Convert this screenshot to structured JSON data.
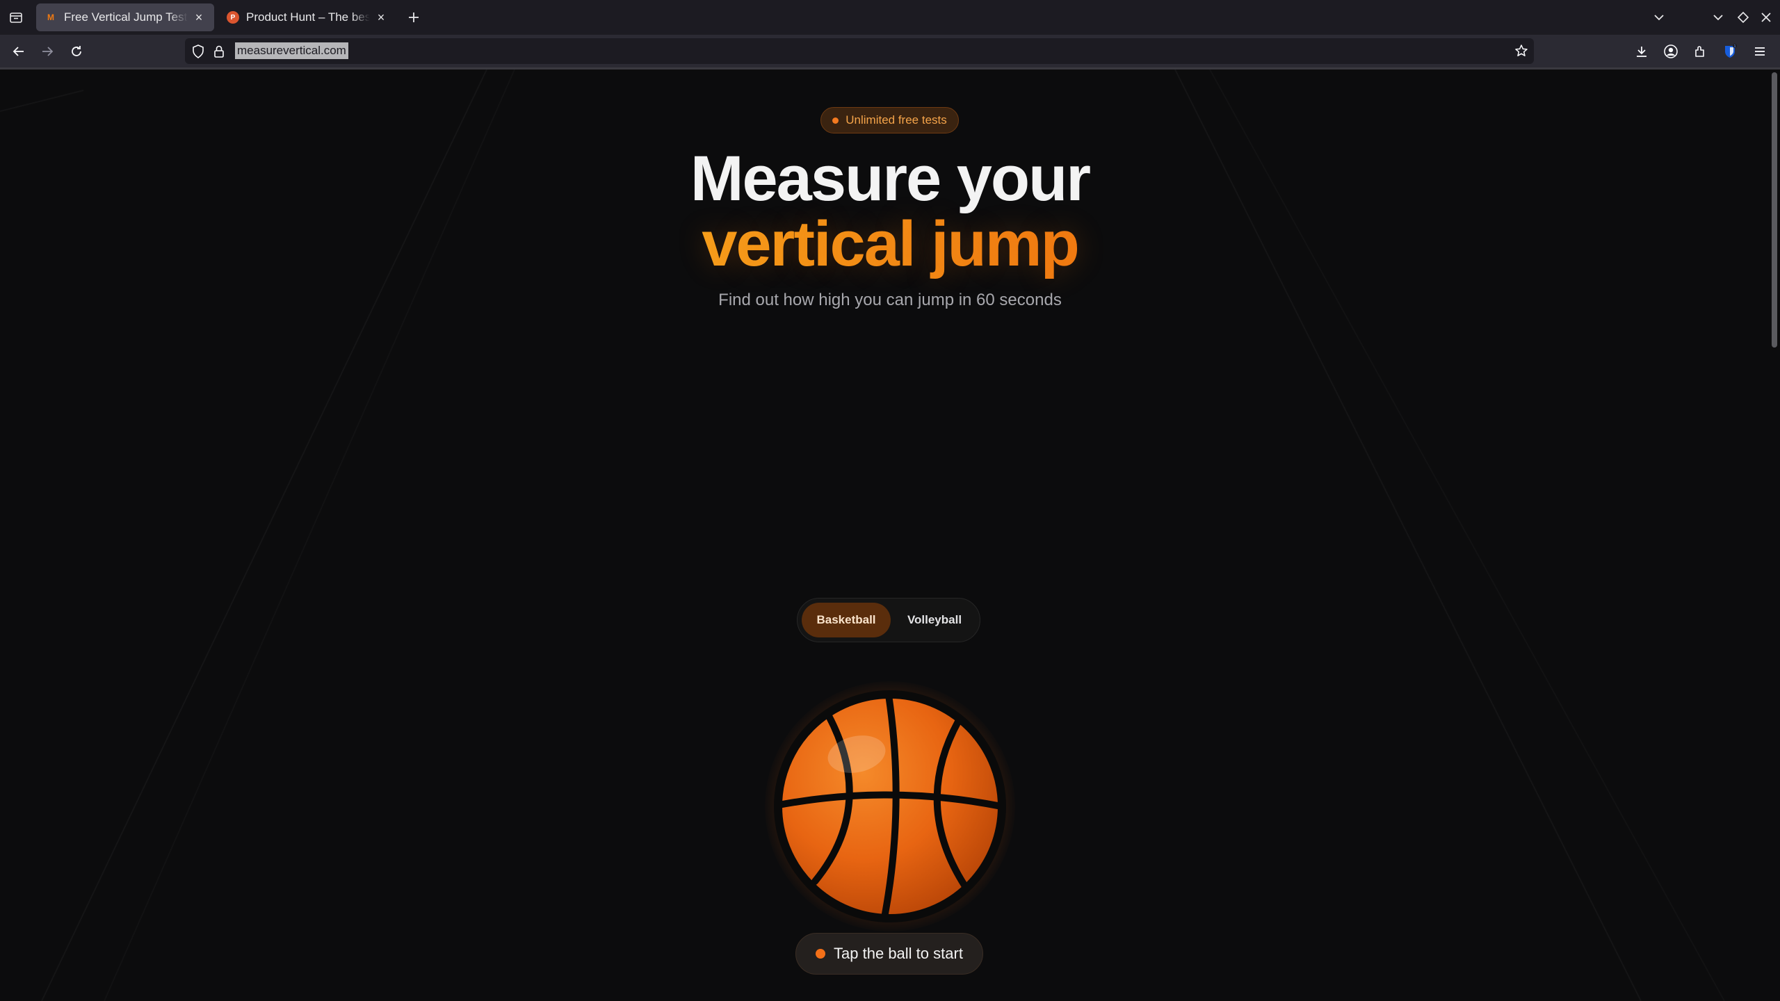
{
  "browser": {
    "tabs": [
      {
        "title": "Free Vertical Jump Test | M",
        "favicon": "measurevertical-favicon",
        "active": true
      },
      {
        "title": "Product Hunt – The best ne",
        "favicon": "producthunt-favicon",
        "active": false
      }
    ],
    "url": "measurevertical.com",
    "favicon_letters": {
      "m": "M",
      "p": "P"
    }
  },
  "page": {
    "badge": "Unlimited free tests",
    "headline_line1": "Measure your",
    "headline_line2": "vertical jump",
    "subtitle": "Find out how high you can jump in 60 seconds",
    "sport_toggle": {
      "options": [
        "Basketball",
        "Volleyball"
      ],
      "selected": "Basketball"
    },
    "start_prompt": "Tap the ball to start"
  },
  "colors": {
    "accent": "#f47a20",
    "background": "#0c0c0d"
  },
  "icons": [
    "tab-overview-icon",
    "close-icon",
    "plus-icon",
    "chevron-down-icon",
    "back-icon",
    "forward-icon",
    "reload-icon",
    "shield-icon",
    "lock-icon",
    "star-icon",
    "download-icon",
    "account-icon",
    "extensions-icon",
    "bitwarden-icon",
    "menu-icon",
    "basketball-icon"
  ]
}
